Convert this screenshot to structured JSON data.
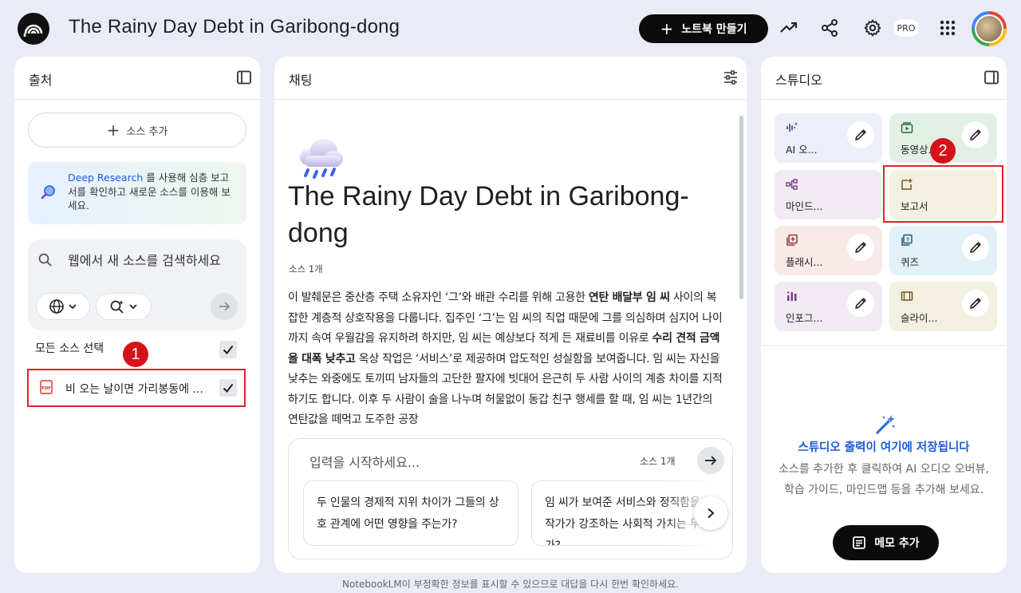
{
  "header": {
    "notebook_title": "The Rainy Day Debt in Garibong-dong",
    "create_button": "노트북 만들기",
    "pro_badge": "PRO"
  },
  "sources_panel": {
    "title": "출처",
    "add_source": "소스 추가",
    "research_link": "Deep Research",
    "research_text": " 를 사용해 심층 보고서를 확인하고 새로운 소스를 이용해 보세요.",
    "web_search_placeholder": "웹에서 새 소스를 검색하세요",
    "select_all": "모든 소스 선택",
    "sources": [
      {
        "label": "비 오는 날이면 가리봉동에 ...",
        "type": "PDF",
        "checked": true
      }
    ]
  },
  "chat_panel": {
    "title": "채팅",
    "doc_title": "The Rainy Day Debt in Garibong-dong",
    "source_count": "소스 1개",
    "summary_parts": [
      {
        "text": "이 발췌문은 중산층 주택 소유자인 ‘그’와 배관 수리를 위해 고용한 ",
        "bold": false
      },
      {
        "text": "연탄 배달부 임 씨",
        "bold": true
      },
      {
        "text": " 사이의 복잡한 계층적 상호작용을 다룹니다. 집주인 ‘그’는 임 씨의 직업 때문에 그를 의심하며 심지어 나이까지 속여 우월감을 유지하려 하지만, 임 씨는 예상보다 적게 든 재료비를 이유로 ",
        "bold": false
      },
      {
        "text": "수리 견적 금액을 대폭 낮추고",
        "bold": true
      },
      {
        "text": " 옥상 작업은 ‘서비스’로 제공하며 압도적인 성실함을 보여줍니다. 임 씨는 자신을 낮추는 와중에도 토끼띠 남자들의 고단한 팔자에 빗대어 은근히 두 사람 사이의 계층 차이를 지적하기도 합니다. 이후 두 사람이 술을 나누며 허물없이 동갑 친구 행세를 할 때, 임 씨는 1년간의 연탄값을 떼먹고 도주한 공장",
        "bold": false
      }
    ],
    "input_placeholder": "입력을 시작하세요...",
    "input_source_count": "소스 1개",
    "suggestions": [
      "두 인물의 경제적 지위 차이가 그들의 상호 관계에 어떤 영향을 주는가?",
      "임 씨가 보여준 서비스와 정직함을 통해 작가가 강조하는 사회적 가치는 무엇인가?"
    ]
  },
  "studio_panel": {
    "title": "스튜디오",
    "tiles": [
      {
        "label": "AI 오...",
        "icon": "audio-overview-icon",
        "bg": "#eceef8",
        "editable": true
      },
      {
        "label": "동영상...",
        "icon": "video-overview-icon",
        "bg": "#e2efe4",
        "editable": true
      },
      {
        "label": "마인드...",
        "icon": "mindmap-icon",
        "bg": "#f1eaf3",
        "editable": false
      },
      {
        "label": "보고서",
        "icon": "report-icon",
        "bg": "#f3f0e1",
        "editable": false
      },
      {
        "label": "플래시...",
        "icon": "flashcard-icon",
        "bg": "#f8eae8",
        "editable": true
      },
      {
        "label": "퀴즈",
        "icon": "quiz-icon",
        "bg": "#e2f1f7",
        "editable": true
      },
      {
        "label": "인포그...",
        "icon": "infographic-icon",
        "bg": "#f1eaf3",
        "editable": true
      },
      {
        "label": "슬라이...",
        "icon": "slides-icon",
        "bg": "#f3f0e1",
        "editable": true
      }
    ],
    "empty_title": "스튜디오 출력이 여기에 저장됩니다",
    "empty_desc": "소스를 추가한 후 클릭하여 AI 오디오 오버뷰, 학습 가이드, 마인드맵 등을 추가해 보세요.",
    "memo_button": "메모 추가"
  },
  "annotations": {
    "marker_1": "1",
    "marker_2": "2"
  },
  "footer": "NotebookLM이 부정확한 정보를 표시할 수 있으므로 대답을 다시 한번 확인하세요."
}
